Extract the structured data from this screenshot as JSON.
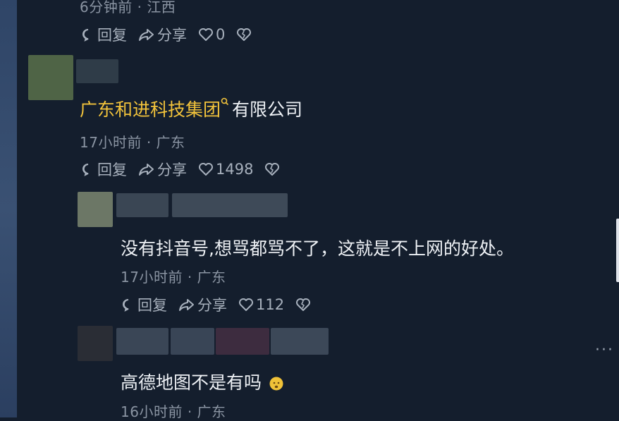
{
  "comments": [
    {
      "time": "6分钟前",
      "location": "江西",
      "reply_label": "回复",
      "share_label": "分享",
      "likes": "0"
    },
    {
      "text_highlight": "广东和进科技集团",
      "text_rest": "有限公司",
      "time": "17小时前",
      "location": "广东",
      "reply_label": "回复",
      "share_label": "分享",
      "likes": "1498"
    },
    {
      "text": "没有抖音号,想骂都骂不了，这就是不上网的好处。",
      "time": "17小时前",
      "location": "广东",
      "reply_label": "回复",
      "share_label": "分享",
      "likes": "112"
    },
    {
      "text": "高德地图不是有吗",
      "time": "16小时前",
      "location": "广东"
    }
  ],
  "meta_separator": "·",
  "more_label": "···",
  "colors": {
    "background": "#141e2d",
    "highlight": "#f2c33b",
    "meta": "#8a94a2"
  },
  "icons": [
    "comment-icon",
    "share-arrow-icon",
    "heart-icon",
    "broken-heart-icon",
    "search-icon",
    "emoji-icon"
  ]
}
